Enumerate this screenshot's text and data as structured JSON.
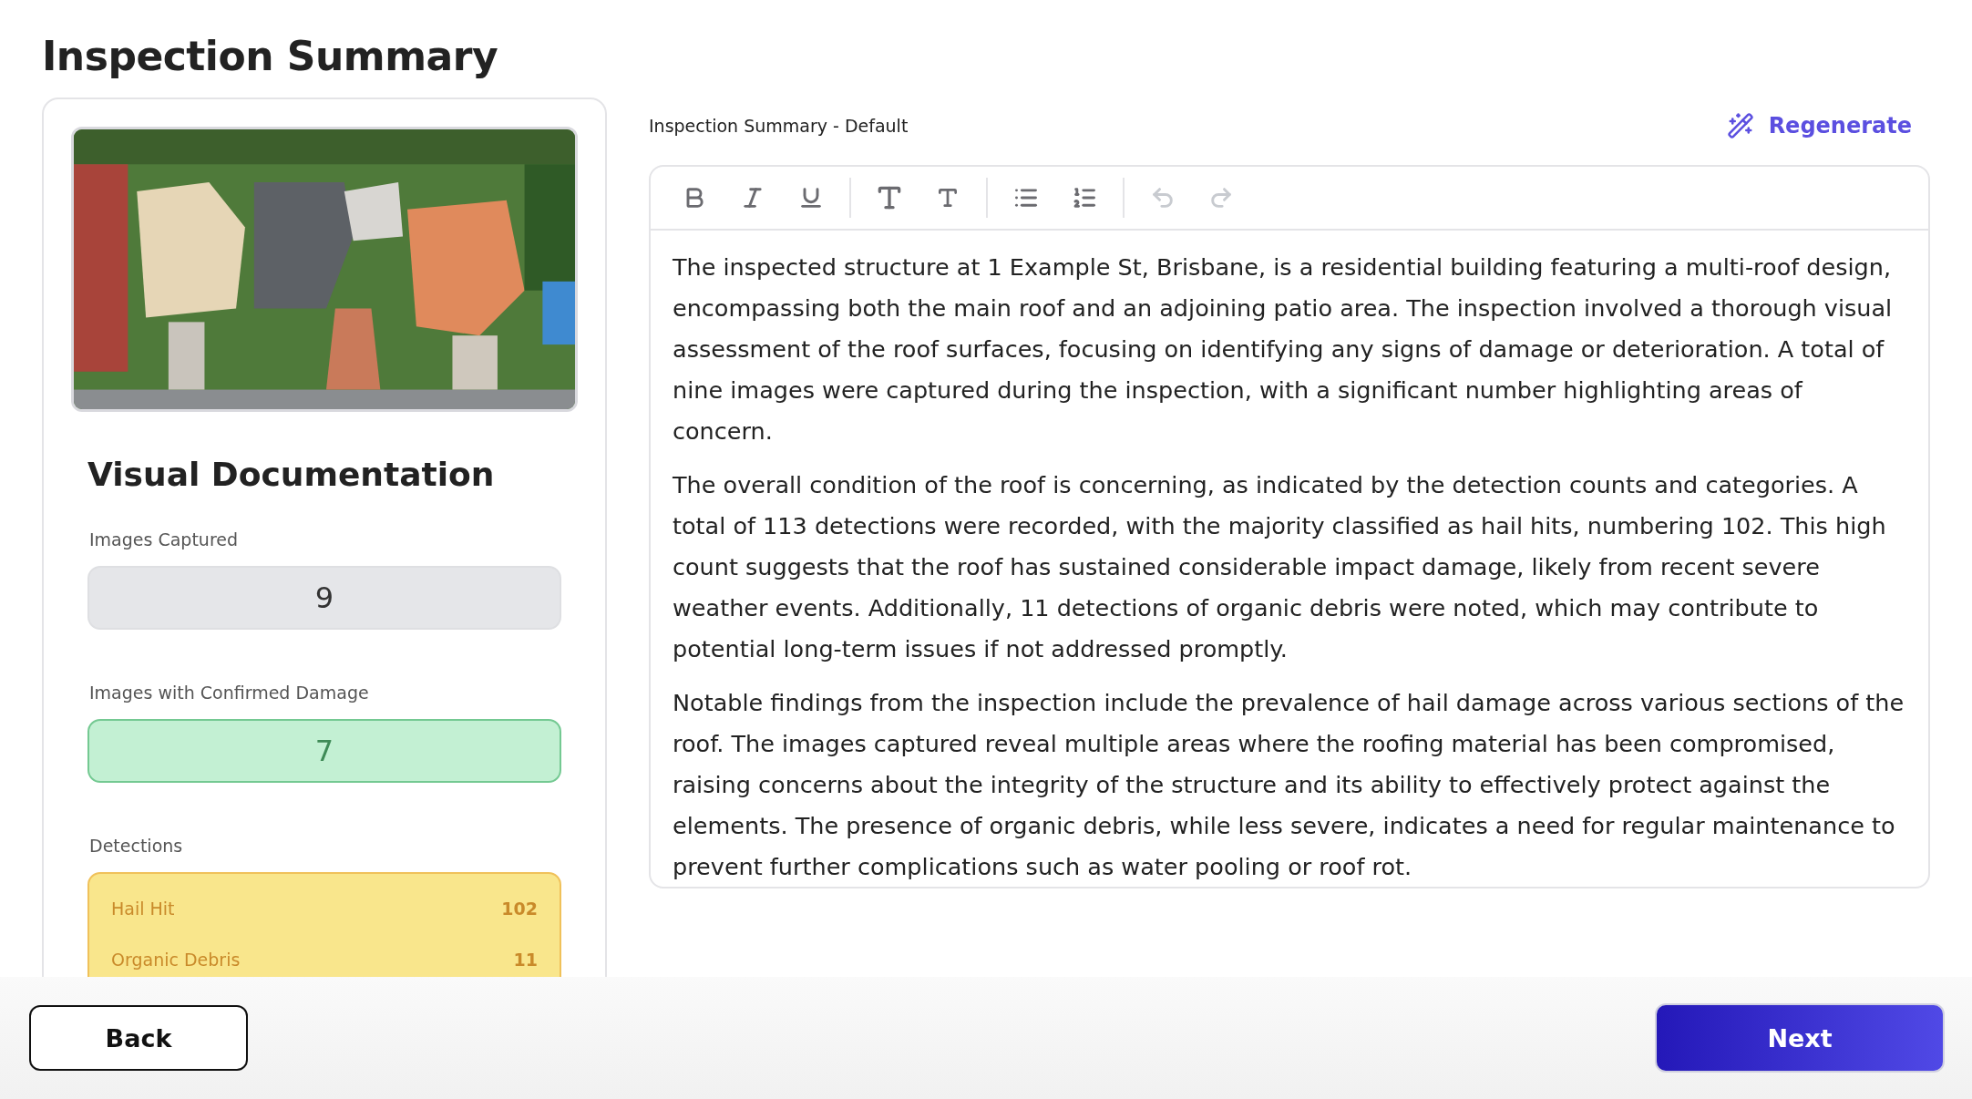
{
  "page_title": "Inspection Summary",
  "left_panel": {
    "heading": "Visual Documentation",
    "stats": [
      {
        "label": "Images Captured",
        "value": "9",
        "kind": "neutral"
      },
      {
        "label": "Images with Confirmed Damage",
        "value": "7",
        "kind": "success"
      }
    ],
    "detections": {
      "label": "Detections",
      "items": [
        {
          "name": "Hail Hit",
          "count": "102"
        },
        {
          "name": "Organic Debris",
          "count": "11"
        }
      ]
    }
  },
  "editor": {
    "label": "Inspection Summary - Default",
    "regenerate": "Regenerate",
    "toolbar": [
      {
        "kind": "bold",
        "disabled": false
      },
      {
        "kind": "italic",
        "disabled": false
      },
      {
        "kind": "underline",
        "disabled": false
      },
      {
        "kind": "heading-large",
        "disabled": false
      },
      {
        "kind": "heading-small",
        "disabled": false
      },
      {
        "kind": "bullet-list",
        "disabled": false
      },
      {
        "kind": "ordered-list",
        "disabled": false
      },
      {
        "kind": "undo",
        "disabled": true
      },
      {
        "kind": "redo",
        "disabled": true
      }
    ],
    "paragraphs": [
      "The inspected structure at 1 Example St, Brisbane, is a residential building featuring a multi-roof design, encompassing both the main roof and an adjoining patio area. The inspection involved a thorough visual assessment of the roof surfaces, focusing on identifying any signs of damage or deterioration. A total of nine images were captured during the inspection, with a significant number highlighting areas of concern.",
      "The overall condition of the roof is concerning, as indicated by the detection counts and categories. A total of 113 detections were recorded, with the majority classified as hail hits, numbering 102. This high count suggests that the roof has sustained considerable impact damage, likely from recent severe weather events. Additionally, 11 detections of organic debris were noted, which may contribute to potential long-term issues if not addressed promptly.",
      "Notable findings from the inspection include the prevalence of hail damage across various sections of the roof. The images captured reveal multiple areas where the roofing material has been compromised, raising concerns about the integrity of the structure and its ability to effectively protect against the elements. The presence of organic debris, while less severe, indicates a need for regular maintenance to prevent further complications such as water pooling or roof rot."
    ]
  },
  "footer": {
    "back": "Back",
    "next": "Next"
  }
}
